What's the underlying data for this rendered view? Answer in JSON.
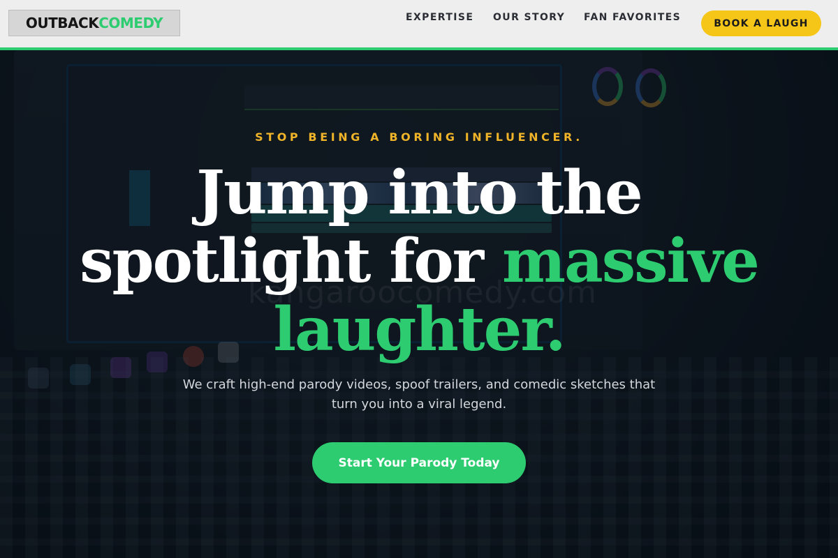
{
  "header": {
    "logo": {
      "part1": "OUTBACK",
      "part2": "COMEDY"
    },
    "nav": [
      {
        "label": "EXPERTISE"
      },
      {
        "label": "OUR STORY"
      },
      {
        "label": "FAN FAVORITES"
      }
    ],
    "book_button": "BOOK A LAUGH"
  },
  "hero": {
    "eyebrow": "STOP BEING A BORING INFLUENCER.",
    "headline": {
      "line1": "Jump into the",
      "line2_white": "spotlight for ",
      "line2_green": "massive",
      "line3_green": "laughter."
    },
    "subtext": "We craft high-end parody videos, spoof trailers, and comedic sketches that turn you into a viral legend.",
    "cta_label": "Start Your Parody Today",
    "watermark": "kangaroocomedy.com"
  },
  "colors": {
    "accent_green": "#2ecc71",
    "accent_yellow": "#f5c518",
    "eyebrow_gold": "#f0b429",
    "header_bg": "#eeeeee"
  }
}
